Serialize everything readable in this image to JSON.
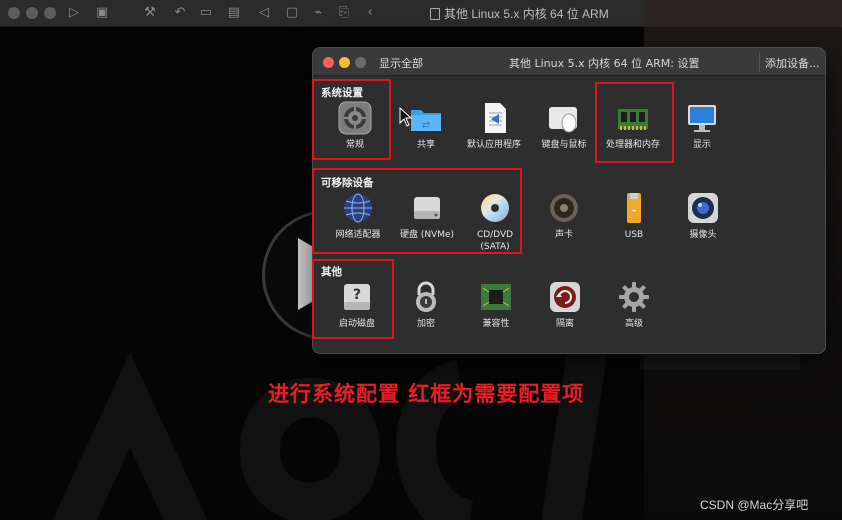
{
  "vm_window": {
    "title": "其他 Linux 5.x 内核 64 位 ARM"
  },
  "settings": {
    "title": "其他 Linux 5.x 内核 64 位 ARM: 设置",
    "show_all": "显示全部",
    "add_device": "添加设备...",
    "sections": {
      "system": "系统设置",
      "removable": "可移除设备",
      "other": "其他"
    },
    "system_items": [
      "常规",
      "共享",
      "默认应用程序",
      "键盘与鼠标",
      "处理器和内存",
      "显示"
    ],
    "removable_items": [
      "网络适配器",
      "硬盘 (NVMe)",
      "CD/DVD",
      "(SATA)",
      "声卡",
      "USB",
      "摄像头"
    ],
    "other_items": [
      "启动磁盘",
      "加密",
      "兼容性",
      "隔离",
      "高级"
    ]
  },
  "caption": "进行系统配置  红框为需要配置项",
  "credit": "CSDN @Mac分享吧",
  "colors": {
    "highlight_red": "#e0141e",
    "caption_red": "#ea1c24",
    "window_bg": "#2e2e2e"
  }
}
